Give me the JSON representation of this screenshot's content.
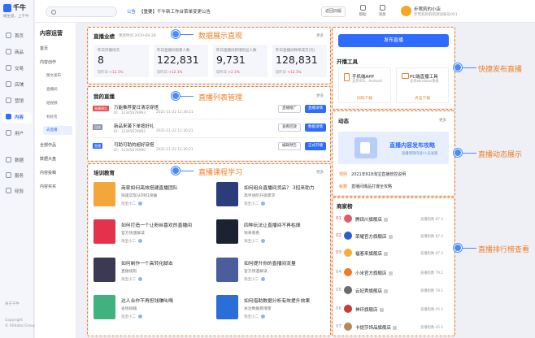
{
  "brand": {
    "name": "千牛",
    "slogan": "做生意，上千牛"
  },
  "sidebar": {
    "items": [
      {
        "label": "首页"
      },
      {
        "label": "商品"
      },
      {
        "label": "交易"
      },
      {
        "label": "店铺"
      },
      {
        "label": "营销"
      },
      {
        "label": "内容"
      },
      {
        "label": "用户"
      },
      {
        "label": "数据"
      },
      {
        "label": "服务"
      },
      {
        "label": "经验"
      }
    ],
    "about": "关于千牛",
    "copyright": "Copyright",
    "company": "© Alibaba Group"
  },
  "subnav": {
    "title": "内容运营",
    "items": [
      {
        "label": "首页"
      },
      {
        "label": "内容创作"
      },
      {
        "label": "图文发布"
      },
      {
        "label": "直播间"
      },
      {
        "label": "短视频"
      },
      {
        "label": "有好货"
      },
      {
        "label": "去直播"
      },
      {
        "label": "全部作品"
      },
      {
        "label": "数据大盘"
      },
      {
        "label": "内容投稿"
      },
      {
        "label": "内容买买"
      }
    ]
  },
  "topbar": {
    "search_placeholder": "",
    "notice_tag": "公告",
    "notice_text": "【重要】千牛新工作台菜单变更公告",
    "old_version": "返回旧版",
    "tools": [
      {
        "label": "帮助"
      },
      {
        "label": "消息"
      }
    ],
    "user_name": "步莺莉的小店",
    "user_id": "步莺莉莉莉莉测试账号001"
  },
  "stats": {
    "title": "直播业绩",
    "update": "更新时间 2020-09-28",
    "more": "更多",
    "items": [
      {
        "label": "昨日开播场次",
        "value": "8",
        "compare": "较昨日",
        "change": "+12.1%"
      },
      {
        "label": "昨日直播间观看人数",
        "value": "122,831",
        "compare": "较昨日",
        "change": "+12.1%"
      },
      {
        "label": "昨日直播间新增粉丝人数",
        "value": "9,731",
        "compare": "较昨日",
        "change": "+2.1%"
      },
      {
        "label": "昨日直播间种草成交(元)",
        "value": "128,831",
        "compare": "较昨日",
        "change": "+12.1%"
      }
    ]
  },
  "lives": {
    "title": "我的直播",
    "more": "更多",
    "items": [
      {
        "tag": "直播预告",
        "tag_color": "#e94b4b",
        "title": "万能推荐夏日清凉穿搭",
        "id": "ID：12345678993",
        "time": "2021-11-22 11:30:21",
        "btn1": "直播推广",
        "btn2": "直播详情"
      },
      {
        "tag": "回放",
        "tag_color": "#8a93a6",
        "title": "新品来袭下单按好礼",
        "id": "ID：12345678992",
        "time": "2021-11-22 11:30:21",
        "btn1": "查看回放",
        "btn2": "数据详情"
      },
      {
        "tag": "直播",
        "tag_color": "#2f6bff",
        "title": "可助可助的超好穿搭",
        "id": "ID：12345678990",
        "time": "2021-11-22 11:30:21",
        "btn1": "编辑预告",
        "btn2": "正式开播"
      }
    ]
  },
  "courses": {
    "title": "培训教育",
    "more": "更多",
    "items": [
      {
        "title": "商家如何高效搭建直播团队",
        "sub": "快速实现从0到1突破",
        "author": "淘宝小二",
        "color": "#f4a63b"
      },
      {
        "title": "如何组合直播间货品？ 3招来助力",
        "sub": "高手进阶升级需求",
        "author": "淘宝小二",
        "color": "#2a3c7a"
      },
      {
        "title": "如何打造一个让粉丝喜欢的直播间",
        "sub": "官方快速解读",
        "author": "淘宝小二",
        "color": "#e4324b"
      },
      {
        "title": "四种玩法让直播间不再枯燥",
        "sub": "快来看看",
        "author": "淘宝小二",
        "color": "#1d2233"
      },
      {
        "title": "如何制作一个高转化脚本",
        "sub": "直播规则",
        "author": "淘宝小二",
        "color": "#3c3a52"
      },
      {
        "title": "如何提升你的直播间流量",
        "sub": "官方快速解读",
        "author": "淘宝小二",
        "color": "#4a5d9c"
      },
      {
        "title": "达人合作不再担钱赚吆喝",
        "sub": "省钱秘籍",
        "author": "淘宝小二",
        "color": "#3fb27f"
      },
      {
        "title": "如何借助数据分析有效提升效果",
        "sub": "关注数据看增量",
        "author": "淘宝小二",
        "color": "#2a6fd8"
      }
    ]
  },
  "right": {
    "publish": "发布直播",
    "tools_title": "开播工具",
    "tools": [
      {
        "name": "手机端APP",
        "desc": "支持iOS、Android",
        "link": "扫码下载"
      },
      {
        "name": "PC端直播工具",
        "desc": "支持windows系统",
        "link": "点击下载"
      }
    ],
    "dyn_title": "动态",
    "dyn_more": "更多",
    "banner_title": "直播内容发布攻略",
    "banner_sub": "直播营销内容/人员发版",
    "dyn_items": [
      {
        "tag": "规则",
        "text": "2021年618淘宝直播管控说明"
      },
      {
        "tag": "秘籍",
        "text": "直播间爆品打爆全攻略"
      }
    ],
    "rank_title": "商家榜",
    "rank": [
      {
        "n": "01",
        "name": "腾田川旗舰店",
        "score": "直播指数 87.2",
        "color": "#e25b6a"
      },
      {
        "n": "02",
        "name": "荣耀官方旗舰店",
        "score": "直播指数 87.2",
        "color": "#2b5bd7"
      },
      {
        "n": "03",
        "name": "福客来旗舰店",
        "score": "直播指数 87.2",
        "color": "#f3b134"
      },
      {
        "n": "04",
        "name": "小米官方旗舰店",
        "score": "直播指数 79.1",
        "color": "#f07a26"
      },
      {
        "n": "05",
        "name": "云妃秀旗舰店",
        "score": "直播指数 78.1",
        "color": "#6b6b6b"
      },
      {
        "n": "06",
        "name": "神环旗舰店",
        "score": "直播指数 45.1",
        "color": "#c73b3b"
      },
      {
        "n": "07",
        "name": "卡提莎饰品旗舰店",
        "score": "直播指数 45.1",
        "color": "#b08a5a"
      }
    ]
  },
  "callouts": {
    "stats": "数据展示直观",
    "lives": "直播列表管理",
    "courses": "直播课程学习",
    "publish": "快捷发布直播",
    "dyn": "直播动态展示",
    "rank": "直播排行榜查看"
  },
  "colors": {
    "accent": "#2f6bff",
    "annotation": "#ef7d22",
    "marker": "#4a8cf7"
  }
}
